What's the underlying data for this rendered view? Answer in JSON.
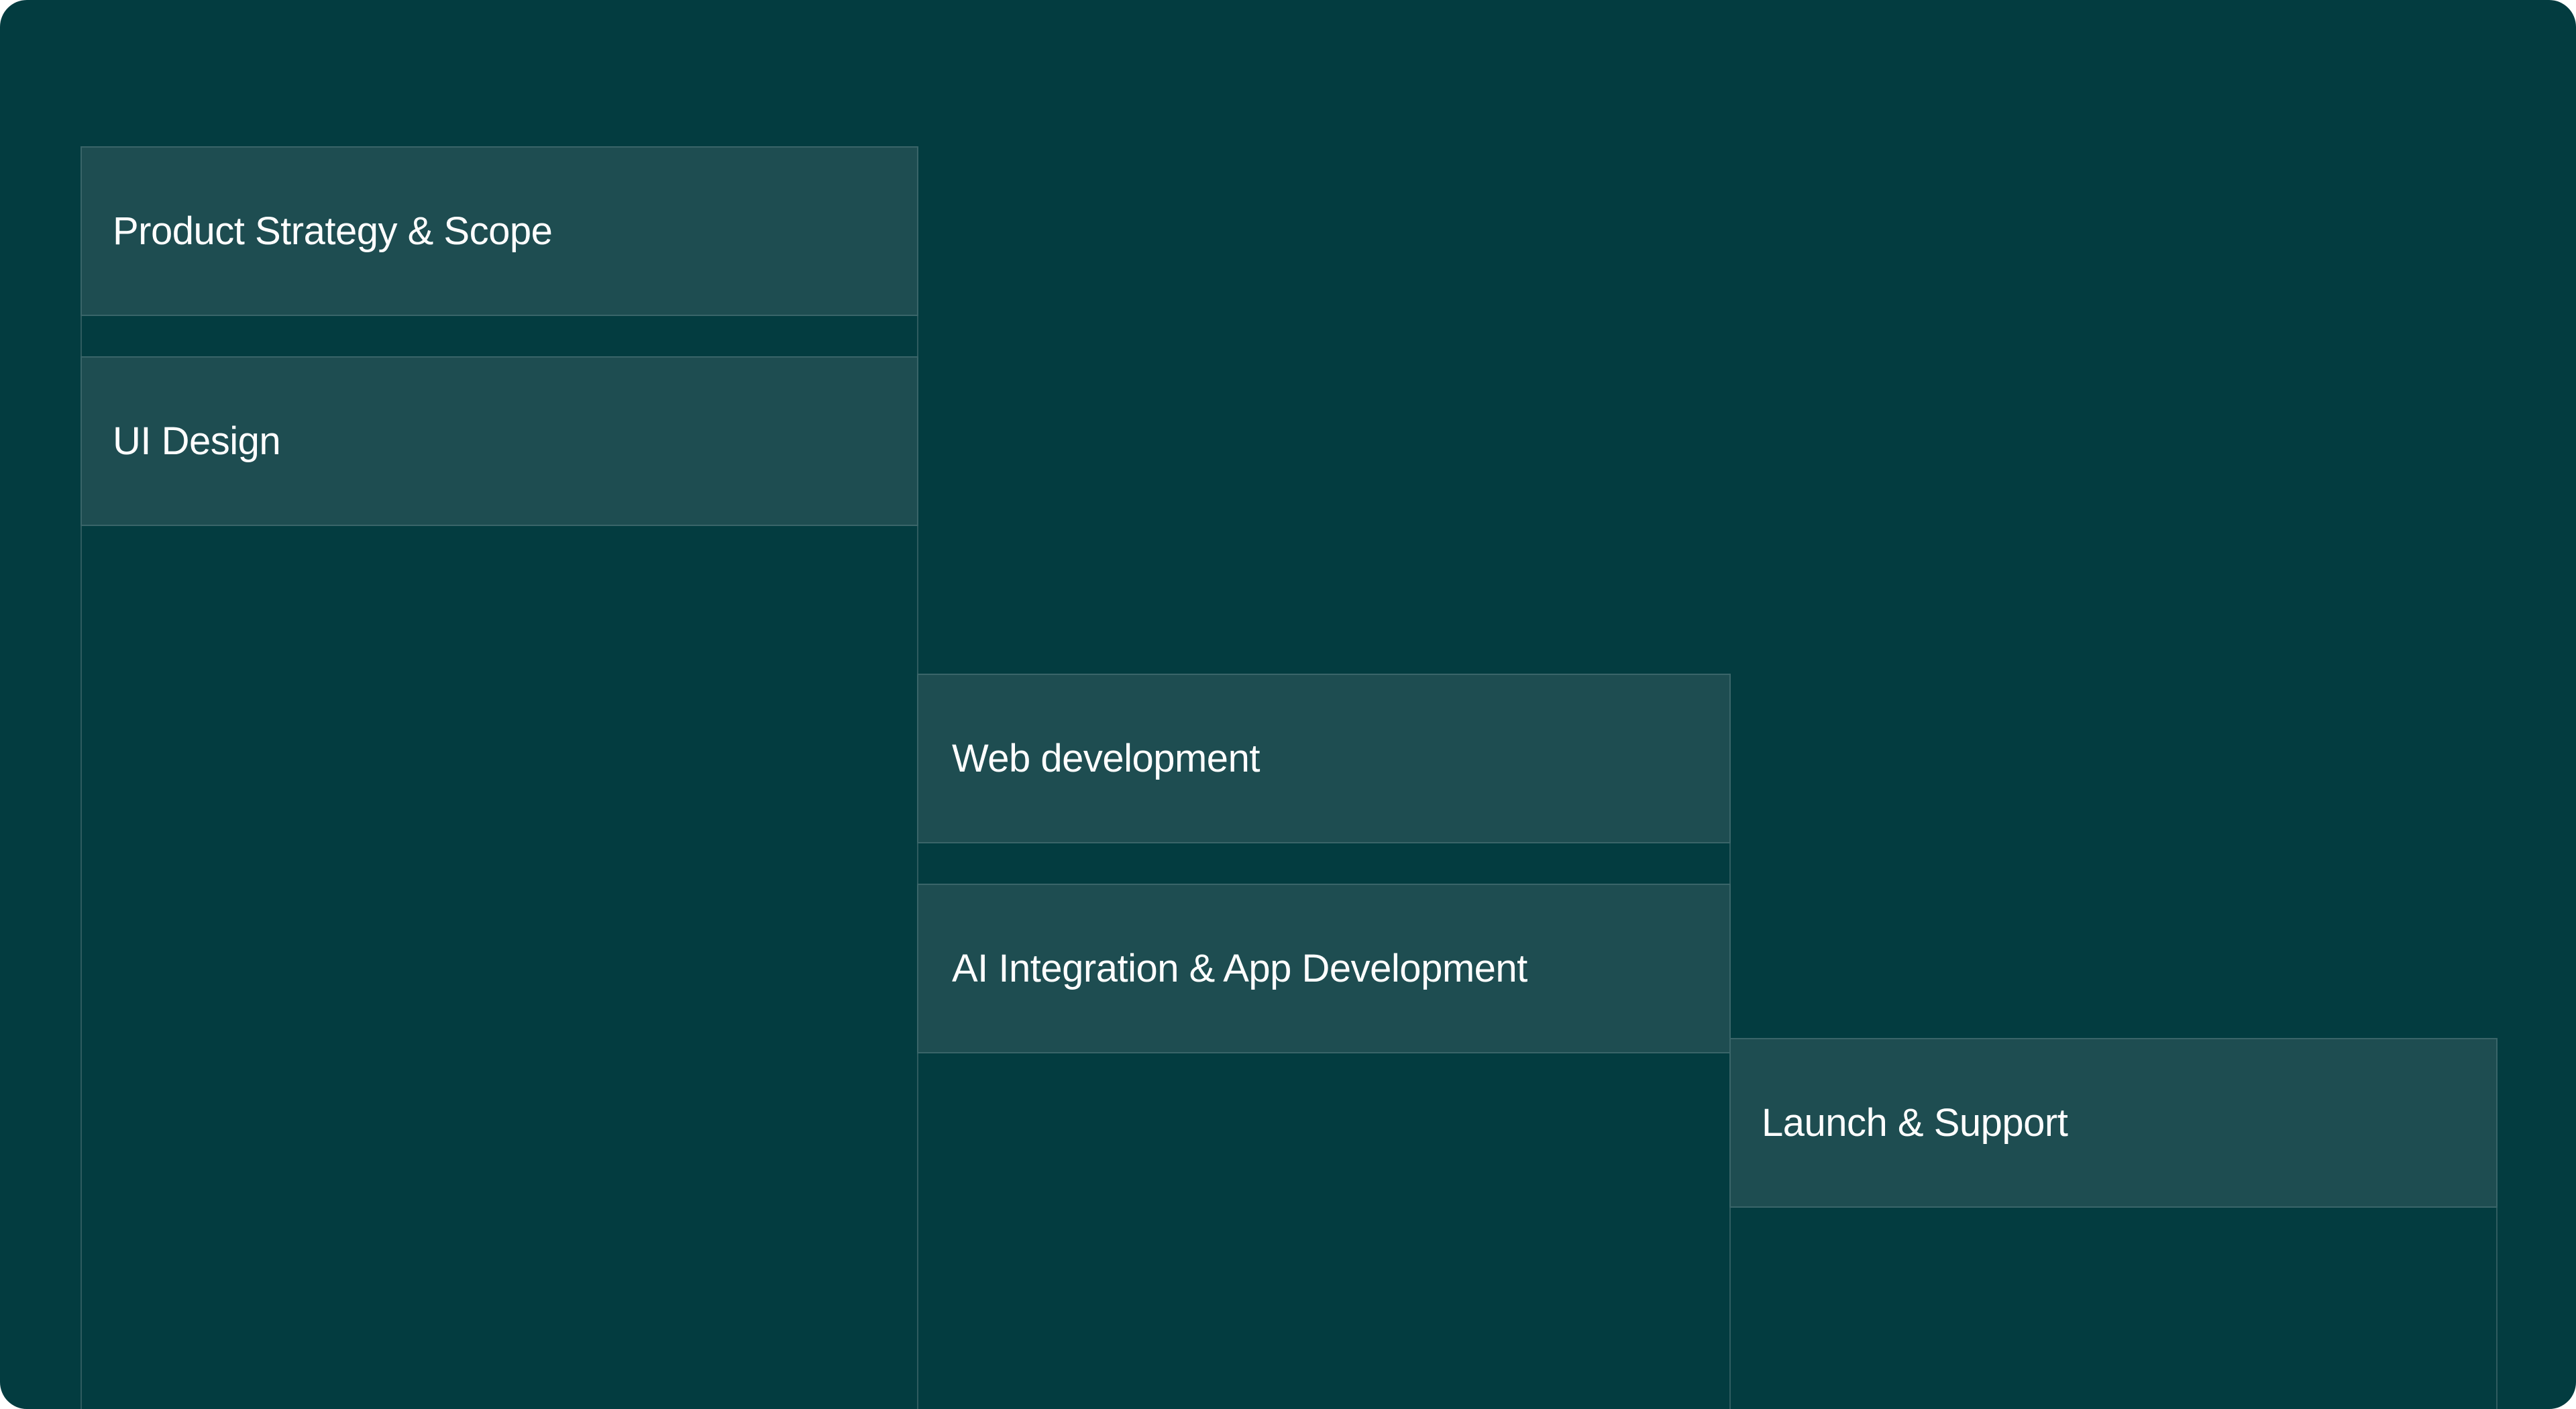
{
  "phases": [
    {
      "label": "Product Strategy & Scope"
    },
    {
      "label": "UI Design"
    },
    {
      "label": "Web development"
    },
    {
      "label": "AI Integration & App Development"
    },
    {
      "label": "Launch & Support"
    }
  ],
  "colors": {
    "background": "#033c40",
    "card": "#1e4d51",
    "card_border": "#3a6569",
    "guide_line": "#2f5c60",
    "text": "#ffffff"
  }
}
